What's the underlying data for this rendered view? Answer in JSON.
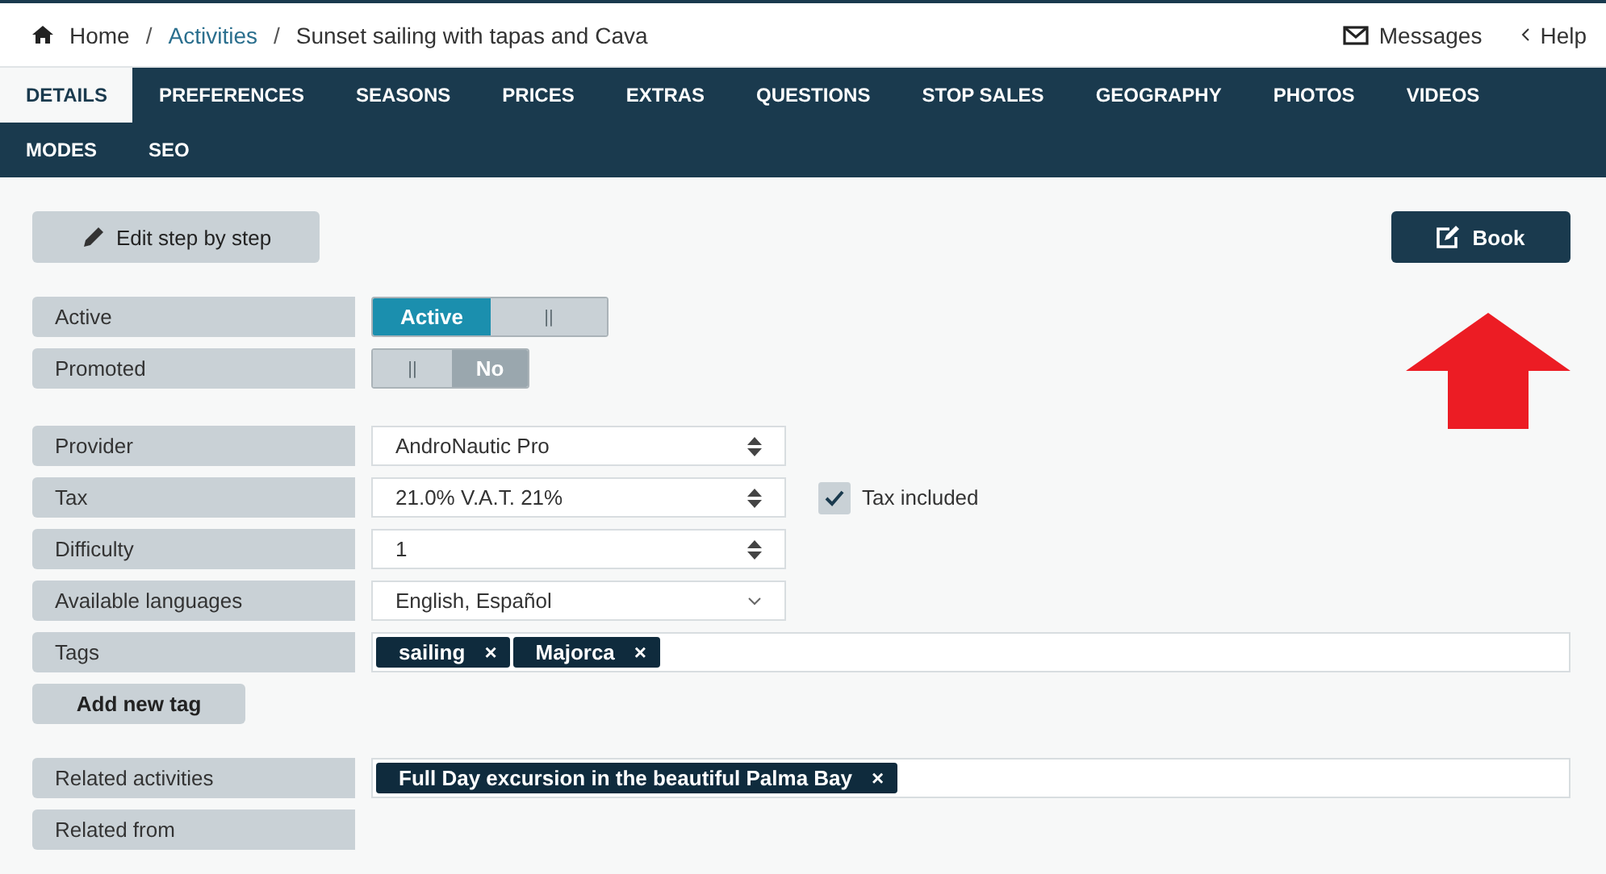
{
  "breadcrumb": [
    {
      "label": "Home",
      "kind": "home"
    },
    {
      "label": "Activities",
      "kind": "link"
    },
    {
      "label": "Sunset sailing with tapas and Cava",
      "kind": "current"
    }
  ],
  "breadcrumb_separator": "/",
  "top_links": [
    {
      "label": "Messages",
      "kind": "mail"
    },
    {
      "label": "Help",
      "kind": "back"
    }
  ],
  "tabs": [
    {
      "label": "DETAILS",
      "selected": true
    },
    {
      "label": "PREFERENCES",
      "selected": false
    },
    {
      "label": "SEASONS",
      "selected": false
    },
    {
      "label": "PRICES",
      "selected": false
    },
    {
      "label": "EXTRAS",
      "selected": false
    },
    {
      "label": "QUESTIONS",
      "selected": false
    },
    {
      "label": "STOP SALES",
      "selected": false
    },
    {
      "label": "GEOGRAPHY",
      "selected": false
    },
    {
      "label": "PHOTOS",
      "selected": false
    },
    {
      "label": "VIDEOS",
      "selected": false
    },
    {
      "label": "MODES",
      "selected": false
    },
    {
      "label": "SEO",
      "selected": false
    }
  ],
  "edit_button": "Edit step by step",
  "book_button": "Book",
  "toggles": [
    {
      "label": "Active",
      "on": true,
      "text": "Active",
      "handle": "||"
    },
    {
      "label": "Promoted",
      "on": false,
      "text": "No",
      "handle": "||"
    }
  ],
  "fields": [
    {
      "label": "Provider",
      "kind": "select",
      "value": "AndroNautic Pro"
    },
    {
      "label": "Tax",
      "kind": "select",
      "value": "21.0% V.A.T. 21%",
      "checkbox": {
        "label": "Tax included",
        "checked": true
      }
    },
    {
      "label": "Difficulty",
      "kind": "select",
      "value": "1"
    },
    {
      "label": "Available languages",
      "kind": "multi",
      "value": "English, Español"
    },
    {
      "label": "Tags",
      "kind": "tags",
      "tags": [
        "sailing",
        "Majorca"
      ],
      "remove": "×"
    }
  ],
  "add_tag_button": "Add new tag",
  "related": [
    {
      "label": "Related activities",
      "kind": "tags",
      "tags": [
        "Full Day excursion in the beautiful Palma Bay"
      ],
      "remove": "×"
    },
    {
      "label": "Related from",
      "kind": "empty"
    }
  ]
}
